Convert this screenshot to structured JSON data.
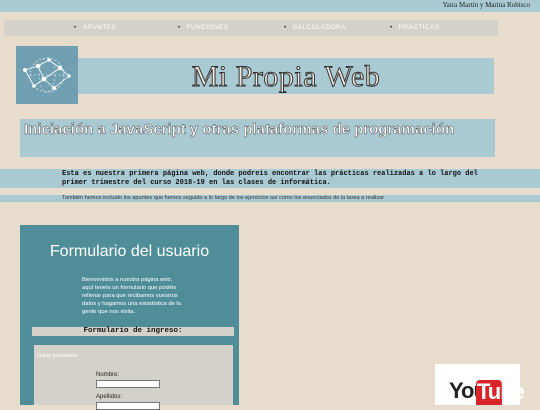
{
  "header": {
    "authors": "Yaira Martín y Marina Robisco"
  },
  "nav": {
    "items": [
      "APUNTES",
      "FUNCIONES",
      "CALCULADORA",
      "PRÁCTICAS"
    ]
  },
  "banner": {
    "logo_icon": "network-globe-icon",
    "title": "Mi Propia Web"
  },
  "subtitle": "Iniciación a JavaScript y otras plataformas de programación",
  "intro": "Esta es nuestra primera página web, donde podreis encontrar las prácticas realizadas a lo largo del primer trimestre del curso 2018-19 en las clases de informática.",
  "note": "También hemos incluido los apuntes que hemos seguido a lo largo de los ejercicios así como los enunciados de la tarea a realizar",
  "form": {
    "title": "Formulario del usuario",
    "welcome": "Bienvenidos a nuestra página web, aquí teneís un formulario que podéis rellenar para que recibamos vuestros datos y hagamos una estadística de la gente que nos visita.",
    "subhead": "Formulario de ingreso:",
    "legend": "Datos personales",
    "nombre_label": "Nombre:",
    "nombre_value": "",
    "apellidos_label": "Apellidos:",
    "apellidos_value": ""
  },
  "youtube": {
    "you": "You",
    "tube": "Tube"
  },
  "colors": {
    "page_bg": "#e8dccc",
    "accent_blue": "#a9c9d3",
    "panel_teal": "#4f8e98",
    "nav_grey": "#d4d0ca",
    "youtube_red": "#d9252a"
  }
}
